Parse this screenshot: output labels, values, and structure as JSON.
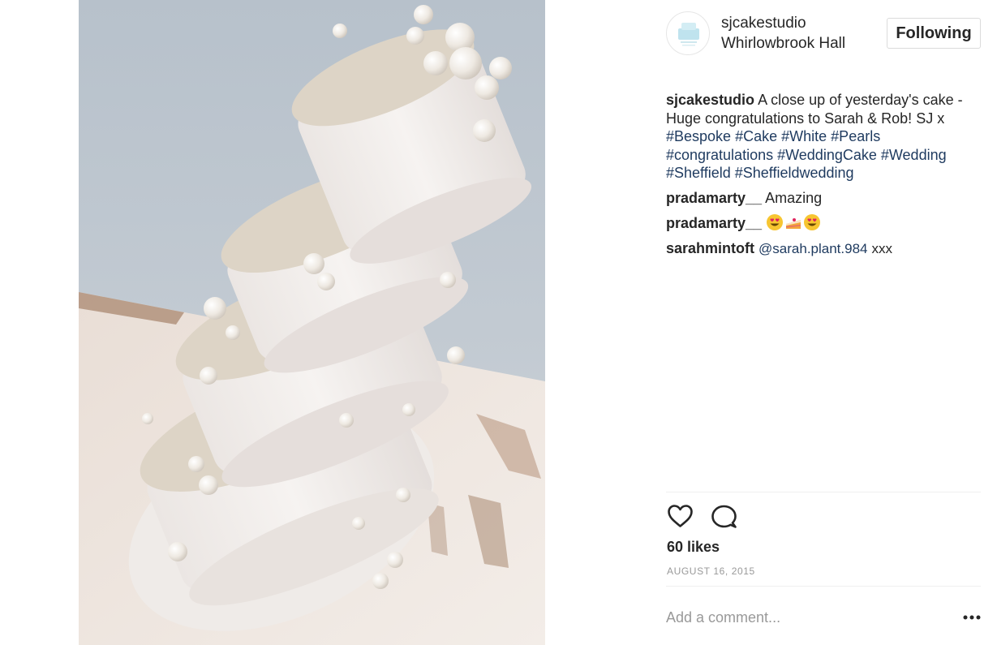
{
  "post": {
    "username": "sjcakestudio",
    "location": "Whirlowbrook Hall",
    "follow_label": "Following",
    "avatar_icon": "cake-studio-logo",
    "photo_subject": "cake-photo"
  },
  "comments": [
    {
      "username": "sjcakestudio",
      "text": "A close up of yesterday's cake - Huge congratulations to Sarah & Rob! SJ x",
      "hashtags": [
        "#Bespoke",
        "#Cake",
        "#White",
        "#Pearls",
        "#congratulations",
        "#WeddingCake",
        "#Wedding",
        "#Sheffield",
        "#Sheffieldwedding"
      ]
    },
    {
      "username": "pradamarty__",
      "text": "Amazing"
    },
    {
      "username": "pradamarty__",
      "emojis": [
        "heart-eyes-emoji",
        "cake-slice-emoji",
        "heart-eyes-emoji"
      ]
    },
    {
      "username": "sarahmintoft",
      "mention": "@sarah.plant.984",
      "text": "xxx"
    }
  ],
  "actions": {
    "like_icon": "heart-icon",
    "comment_icon": "comment-bubble-icon",
    "likes_label": "60 likes",
    "date": "AUGUST 16, 2015",
    "comment_placeholder": "Add a comment...",
    "more_icon": "more-options-icon"
  }
}
